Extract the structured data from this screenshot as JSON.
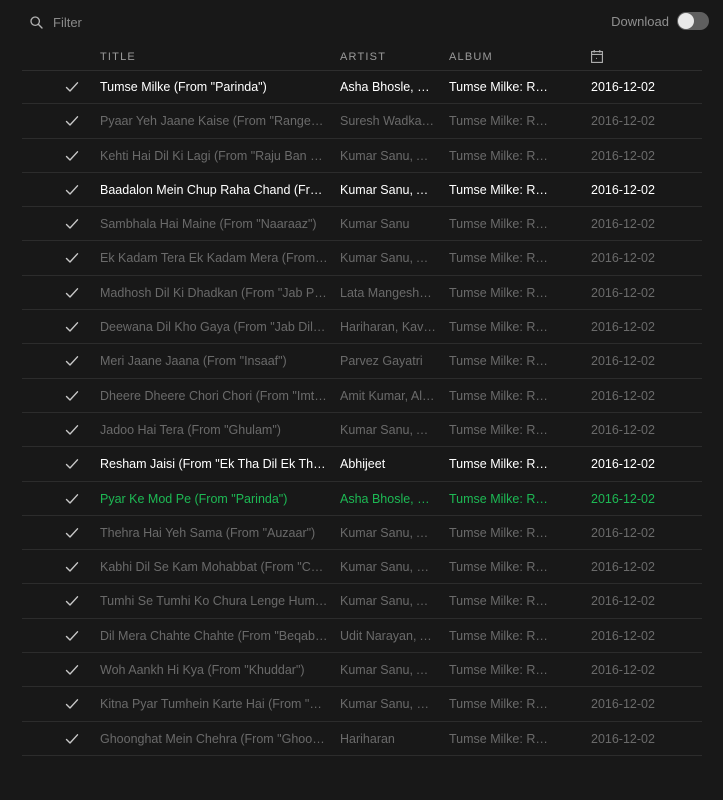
{
  "filter": {
    "placeholder": "Filter"
  },
  "download": {
    "label": "Download",
    "enabled": false
  },
  "columns": {
    "title": "TITLE",
    "artist": "ARTIST",
    "album": "ALBUM",
    "date_icon": "calendar-icon"
  },
  "colors": {
    "playing": "#1db954",
    "background": "#181818",
    "available_text": "#ffffff",
    "unavailable_text": "#6a6a6a"
  },
  "tracks": [
    {
      "title": "Tumse Milke (From \"Parinda\")",
      "artist": "Asha Bhosle, Su...",
      "album": "Tumse Milke: Ro...",
      "date": "2016-12-02",
      "state": "avail"
    },
    {
      "title": "Pyaar Yeh Jaane Kaise (From \"Rangeela\")",
      "artist": "Suresh Wadkar, ...",
      "album": "Tumse Milke: Ro...",
      "date": "2016-12-02",
      "state": "dim"
    },
    {
      "title": "Kehti Hai Dil Ki Lagi (From \"Raju Ban Ga...",
      "artist": "Kumar Sanu, Alk...",
      "album": "Tumse Milke: Ro...",
      "date": "2016-12-02",
      "state": "dim"
    },
    {
      "title": "Baadalon Mein Chup Raha Chand (From...",
      "artist": "Kumar Sanu, Alk...",
      "album": "Tumse Milke: Ro...",
      "date": "2016-12-02",
      "state": "avail"
    },
    {
      "title": "Sambhala Hai Maine (From \"Naaraaz\")",
      "artist": "Kumar Sanu",
      "album": "Tumse Milke: Ro...",
      "date": "2016-12-02",
      "state": "dim"
    },
    {
      "title": "Ek Kadam Tera Ek Kadam Mera (From \"...",
      "artist": "Kumar Sanu, Alk...",
      "album": "Tumse Milke: Ro...",
      "date": "2016-12-02",
      "state": "dim"
    },
    {
      "title": "Madhosh Dil Ki Dhadkan (From \"Jab Pya...",
      "artist": "Lata Mangeshka...",
      "album": "Tumse Milke: Ro...",
      "date": "2016-12-02",
      "state": "dim"
    },
    {
      "title": "Deewana Dil Kho Gaya (From \"Jab Dil Ki...",
      "artist": "Hariharan, Kavit...",
      "album": "Tumse Milke: Ro...",
      "date": "2016-12-02",
      "state": "dim"
    },
    {
      "title": "Meri Jaane Jaana (From \"Insaaf\")",
      "artist": "Parvez Gayatri",
      "album": "Tumse Milke: Ro...",
      "date": "2016-12-02",
      "state": "dim"
    },
    {
      "title": "Dheere Dheere Chori Chori (From \"Imtih...",
      "artist": "Amit Kumar, Alk...",
      "album": "Tumse Milke: Ro...",
      "date": "2016-12-02",
      "state": "dim"
    },
    {
      "title": "Jadoo Hai Tera (From \"Ghulam\")",
      "artist": "Kumar Sanu, Alk...",
      "album": "Tumse Milke: Ro...",
      "date": "2016-12-02",
      "state": "dim"
    },
    {
      "title": "Resham Jaisi (From \"Ek Tha Dil Ek Thi D...",
      "artist": "Abhijeet",
      "album": "Tumse Milke: Ro...",
      "date": "2016-12-02",
      "state": "avail"
    },
    {
      "title": "Pyar Ke Mod Pe (From \"Parinda\")",
      "artist": "Asha Bhosle, Su...",
      "album": "Tumse Milke: Ro...",
      "date": "2016-12-02",
      "state": "playing"
    },
    {
      "title": "Thehra Hai Yeh Sama (From \"Auzaar\")",
      "artist": "Kumar Sanu, Alk...",
      "album": "Tumse Milke: Ro...",
      "date": "2016-12-02",
      "state": "dim"
    },
    {
      "title": "Kabhi Dil Se Kam Mohabbat (From \"Cha...",
      "artist": "Kumar Sanu, Sa...",
      "album": "Tumse Milke: Ro...",
      "date": "2016-12-02",
      "state": "dim"
    },
    {
      "title": "Tumhi Se Tumhi Ko Chura Lenge Hum (F...",
      "artist": "Kumar Sanu, Alk...",
      "album": "Tumse Milke: Ro...",
      "date": "2016-12-02",
      "state": "dim"
    },
    {
      "title": "Dil Mera Chahte Chahte (From \"Beqabu\")",
      "artist": "Udit Narayan, Al...",
      "album": "Tumse Milke: Ro...",
      "date": "2016-12-02",
      "state": "dim"
    },
    {
      "title": "Woh Aankh Hi Kya (From \"Khuddar\")",
      "artist": "Kumar Sanu, Alk...",
      "album": "Tumse Milke: Ro...",
      "date": "2016-12-02",
      "state": "dim"
    },
    {
      "title": "Kitna Pyar Tumhein Karte Hai (From \"Ek ...",
      "artist": "Kumar Sanu, Sa...",
      "album": "Tumse Milke: Ro...",
      "date": "2016-12-02",
      "state": "dim"
    },
    {
      "title": "Ghoonghat Mein Chehra (From \"Ghoon...",
      "artist": "Hariharan",
      "album": "Tumse Milke: Ro...",
      "date": "2016-12-02",
      "state": "dim"
    }
  ]
}
